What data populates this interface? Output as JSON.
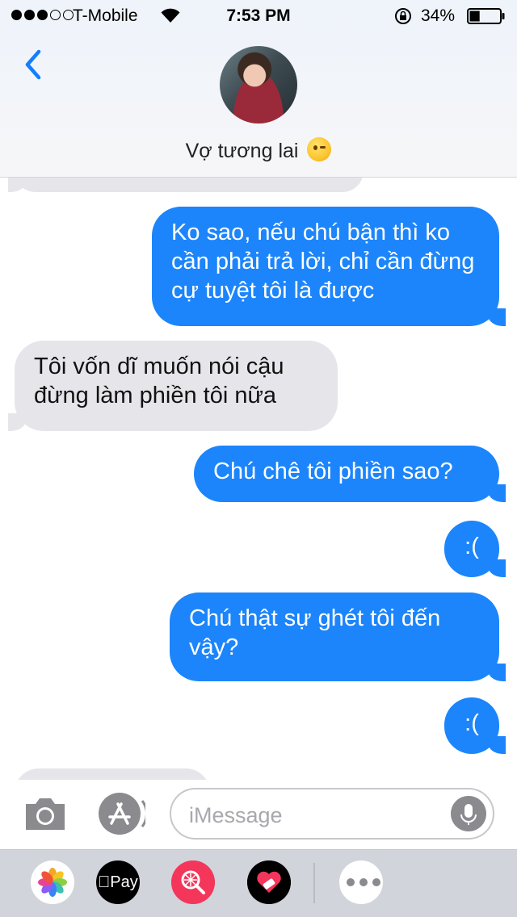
{
  "status_bar": {
    "carrier": "T-Mobile",
    "time": "7:53 PM",
    "battery_percent": "34%",
    "battery_level": 0.34,
    "signal_bars_filled": 3,
    "signal_bars_total": 5
  },
  "header": {
    "contact_name": "Vợ tương lai",
    "contact_emoji": "winking-face-icon"
  },
  "messages": [
    {
      "from": "them",
      "text": ""
    },
    {
      "from": "me",
      "text": "Ko sao, nếu chú bận thì ko cần phải trả lời, chỉ cần đừng cự tuyệt tôi là được"
    },
    {
      "from": "them",
      "text": "Tôi vốn dĩ muốn nói cậu đừng làm phiền tôi nữa"
    },
    {
      "from": "me",
      "text": "Chú chê tôi phiền sao?"
    },
    {
      "from": "me",
      "text": ":("
    },
    {
      "from": "me",
      "text": "Chú thật sự ghét tôi đến vậy?"
    },
    {
      "from": "me",
      "text": ":("
    },
    {
      "from": "them",
      "text": ""
    }
  ],
  "compose": {
    "placeholder": "iMessage"
  },
  "app_drawer": {
    "apple_pay_label": "Pay",
    "apps": [
      "photos-app-icon",
      "apple-pay-app-icon",
      "search-images-app-icon",
      "stickers-app-icon",
      "more-apps-icon"
    ]
  },
  "colors": {
    "sent_bubble": "#1c85fb",
    "received_bubble": "#e6e5ea",
    "accent": "#147efb"
  }
}
